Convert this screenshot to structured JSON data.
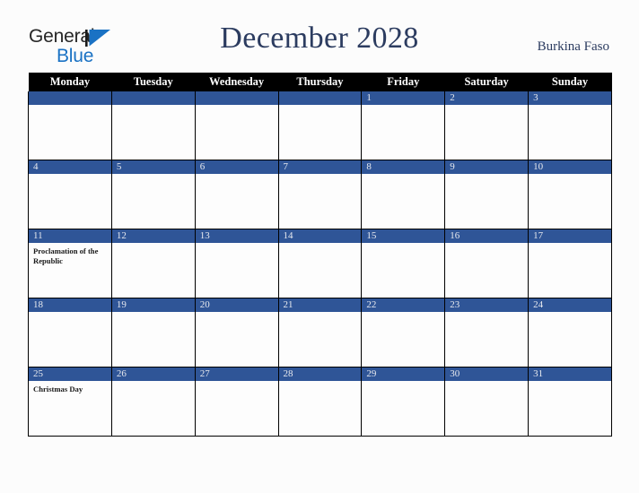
{
  "brand": {
    "line1": "General",
    "line2": "Blue",
    "triangle_color": "#1a72c4",
    "text_color": "#262626"
  },
  "header": {
    "title": "December 2028",
    "country": "Burkina Faso",
    "title_color": "#2c3c60"
  },
  "calendar": {
    "weekday_headers": [
      "Monday",
      "Tuesday",
      "Wednesday",
      "Thursday",
      "Friday",
      "Saturday",
      "Sunday"
    ],
    "header_bg": "#000000",
    "daybar_bg": "#2f5597",
    "cell_bg": "#fdfdfd",
    "weeks": [
      [
        {
          "day": "",
          "holiday": ""
        },
        {
          "day": "",
          "holiday": ""
        },
        {
          "day": "",
          "holiday": ""
        },
        {
          "day": "",
          "holiday": ""
        },
        {
          "day": "1",
          "holiday": ""
        },
        {
          "day": "2",
          "holiday": ""
        },
        {
          "day": "3",
          "holiday": ""
        }
      ],
      [
        {
          "day": "4",
          "holiday": ""
        },
        {
          "day": "5",
          "holiday": ""
        },
        {
          "day": "6",
          "holiday": ""
        },
        {
          "day": "7",
          "holiday": ""
        },
        {
          "day": "8",
          "holiday": ""
        },
        {
          "day": "9",
          "holiday": ""
        },
        {
          "day": "10",
          "holiday": ""
        }
      ],
      [
        {
          "day": "11",
          "holiday": "Proclamation of the Republic"
        },
        {
          "day": "12",
          "holiday": ""
        },
        {
          "day": "13",
          "holiday": ""
        },
        {
          "day": "14",
          "holiday": ""
        },
        {
          "day": "15",
          "holiday": ""
        },
        {
          "day": "16",
          "holiday": ""
        },
        {
          "day": "17",
          "holiday": ""
        }
      ],
      [
        {
          "day": "18",
          "holiday": ""
        },
        {
          "day": "19",
          "holiday": ""
        },
        {
          "day": "20",
          "holiday": ""
        },
        {
          "day": "21",
          "holiday": ""
        },
        {
          "day": "22",
          "holiday": ""
        },
        {
          "day": "23",
          "holiday": ""
        },
        {
          "day": "24",
          "holiday": ""
        }
      ],
      [
        {
          "day": "25",
          "holiday": "Christmas Day"
        },
        {
          "day": "26",
          "holiday": ""
        },
        {
          "day": "27",
          "holiday": ""
        },
        {
          "day": "28",
          "holiday": ""
        },
        {
          "day": "29",
          "holiday": ""
        },
        {
          "day": "30",
          "holiday": ""
        },
        {
          "day": "31",
          "holiday": ""
        }
      ]
    ]
  }
}
